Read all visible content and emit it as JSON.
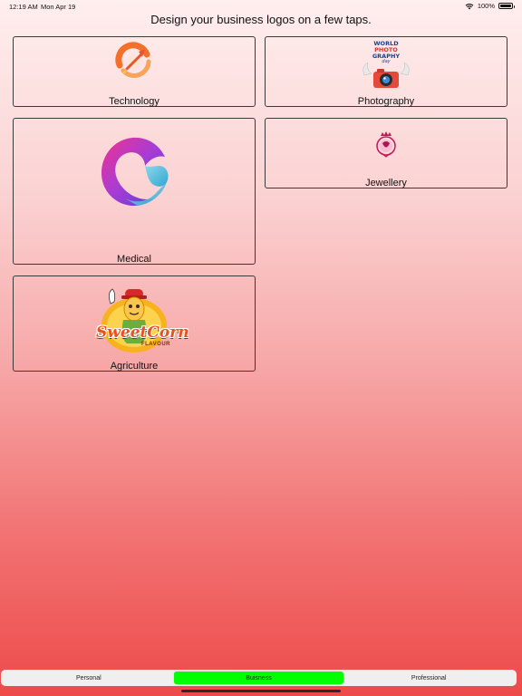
{
  "status_bar": {
    "time": "12:19 AM",
    "date": "Mon Apr 19",
    "battery_percent": "100%",
    "battery_level": 1.0,
    "wifi_icon": "wifi-icon",
    "battery_icon": "battery-icon"
  },
  "headline": "Design your business logos on a few taps.",
  "categories": [
    {
      "label": "Technology",
      "icon": "rocket-logo-icon"
    },
    {
      "label": "Photography",
      "icon": "world-photography-day-logo-icon",
      "logo_text": [
        "WORLD",
        "PHOTO",
        "GRAPHY",
        "day"
      ]
    },
    {
      "label": "Medical",
      "icon": "heart-logo-icon"
    },
    {
      "label": "Jewellery",
      "icon": "jewellery-crest-logo-icon"
    },
    {
      "label": "Agriculture",
      "icon": "sweetcorn-mascot-logo-icon",
      "logo_text": [
        "SweetCorn",
        "FLAVOUR"
      ]
    }
  ],
  "tabs": [
    {
      "label": "Personal",
      "selected": false
    },
    {
      "label": "Buisness",
      "selected": true
    },
    {
      "label": "Professional",
      "selected": false
    }
  ],
  "colors": {
    "selected_tab": "#00ff00",
    "card_border": "#3a3a3a",
    "gradient_top": "#ffeeee",
    "gradient_bottom": "#ee4a4a"
  }
}
